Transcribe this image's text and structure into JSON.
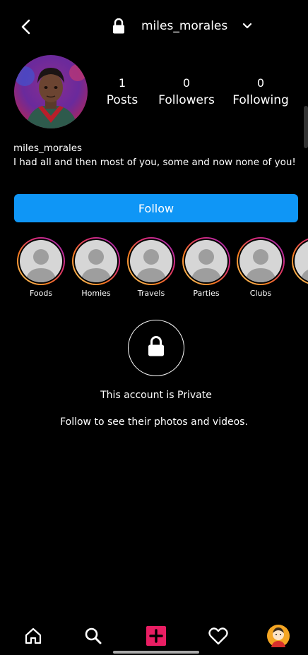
{
  "header": {
    "username": "miles_morales",
    "icons": {
      "back": "back-arrow-icon",
      "lock": "lock-icon",
      "dropdown": "chevron-down-icon"
    }
  },
  "profile": {
    "stats": [
      {
        "count": "1",
        "label": "Posts"
      },
      {
        "count": "0",
        "label": "Followers"
      },
      {
        "count": "0",
        "label": "Following"
      }
    ],
    "bio_name": "miles_morales",
    "bio_text": "I had all and then most of you,  some and now none of you!"
  },
  "actions": {
    "follow_label": "Follow",
    "follow_color": "#0f96f6"
  },
  "highlights": [
    {
      "label": "Foods"
    },
    {
      "label": "Homies"
    },
    {
      "label": "Travels"
    },
    {
      "label": "Parties"
    },
    {
      "label": "Clubs"
    }
  ],
  "private": {
    "title": "This account is Private",
    "subtitle": "Follow to see their photos and videos."
  },
  "nav": {
    "items": [
      "home-icon",
      "search-icon",
      "add-post-icon",
      "heart-icon",
      "profile-avatar-icon"
    ],
    "accent": "#e91e63"
  }
}
